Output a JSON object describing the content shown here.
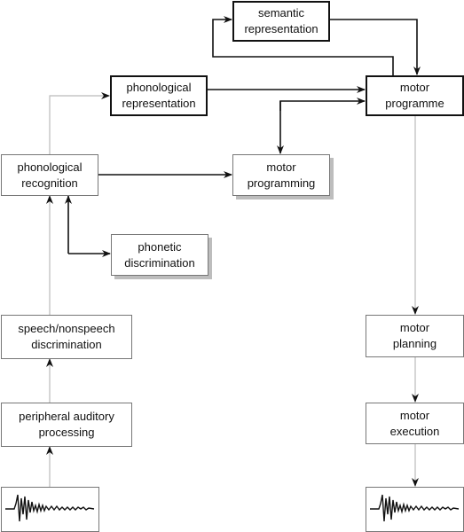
{
  "boxes": {
    "semantic_representation": "semantic\nrepresentation",
    "phonological_representation": "phonological\nrepresentation",
    "motor_programme": "motor\nprogramme",
    "phonological_recognition": "phonological\nrecognition",
    "motor_programming": "motor\nprogramming",
    "phonetic_discrimination": "phonetic\ndiscrimination",
    "speech_nonspeech_discrimination": "speech/nonspeech\ndiscrimination",
    "peripheral_auditory_processing": "peripheral auditory\nprocessing",
    "motor_planning": "motor\nplanning",
    "motor_execution": "motor\nexecution"
  },
  "icons": {
    "input_waveform": "speech-waveform-icon",
    "output_waveform": "speech-waveform-icon"
  },
  "colors": {
    "strong_link": "#111111",
    "weak_link": "#bbbbbb",
    "shadow": "#bdbdbd"
  }
}
